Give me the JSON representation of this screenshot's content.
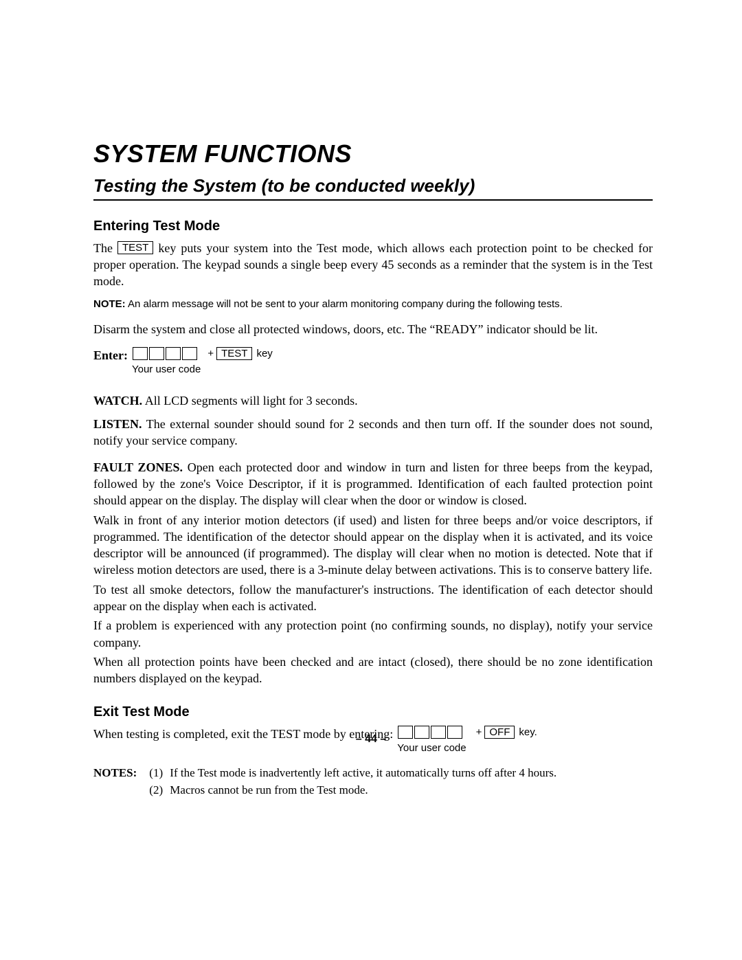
{
  "heading1": "SYSTEM FUNCTIONS",
  "heading2": "Testing the System (to be conducted weekly)",
  "section1_heading": "Entering Test Mode",
  "para1_a": "The ",
  "key_test": "TEST",
  "para1_b": " key puts your system into the Test mode, which allows each protection point to be checked for proper operation. The keypad sounds a single beep every 45 seconds as a reminder that the system is in the Test mode.",
  "note_label": "NOTE:",
  "note_text": "  An alarm message will not be sent to your alarm monitoring company during the following tests.",
  "para2": "Disarm the system and close all protected windows, doors, etc. The “READY” indicator should be lit.",
  "enter_label": "Enter:",
  "user_code_label": "Your user code",
  "plus_sign": "+",
  "key_word": "key",
  "watch_label": "WATCH.",
  "watch_text": " All LCD segments will light for 3 seconds.",
  "listen_label": "LISTEN.",
  "listen_text": " The external sounder should sound for 2 seconds and then turn off. If the sounder does not sound, notify your service company.",
  "fault_label": "FAULT ZONES.",
  "fault_text": " Open each protected door and window in turn and listen for three beeps from the keypad, followed by the zone's Voice Descriptor, if it is programmed. Identification of each faulted protection point should appear on the display. The display will clear when the door or window is closed.",
  "para_walk": "Walk in front of any interior motion detectors (if used) and listen for three beeps and/or voice descriptors, if programmed. The identification of the detector should appear on the display when it is activated, and its voice descriptor will be announced (if programmed). The display will clear when no motion is detected. Note that if wireless motion detectors are used, there is a 3-minute delay between activations. This is to conserve battery life.",
  "para_smoke": "To test all smoke detectors, follow the manufacturer's instructions. The identification of each detector should appear on the display when each is activated.",
  "para_problem": "If a problem is experienced with any protection point (no confirming sounds, no display), notify your service company.",
  "para_when": "When all protection points have been checked and are intact (closed), there should be no zone identification numbers displayed on the keypad.",
  "section2_heading": "Exit Test Mode",
  "exit_text": "When testing is completed, exit the TEST mode by entering: ",
  "key_off": "OFF",
  "exit_key_suffix": " key.",
  "notes_label": "NOTES:",
  "notes": [
    {
      "num": "(1)",
      "text": "If the Test mode is inadvertently left active, it automatically turns off after 4 hours."
    },
    {
      "num": "(2)",
      "text": "Macros cannot be run from the Test mode."
    }
  ],
  "page_number": "– 44 –"
}
